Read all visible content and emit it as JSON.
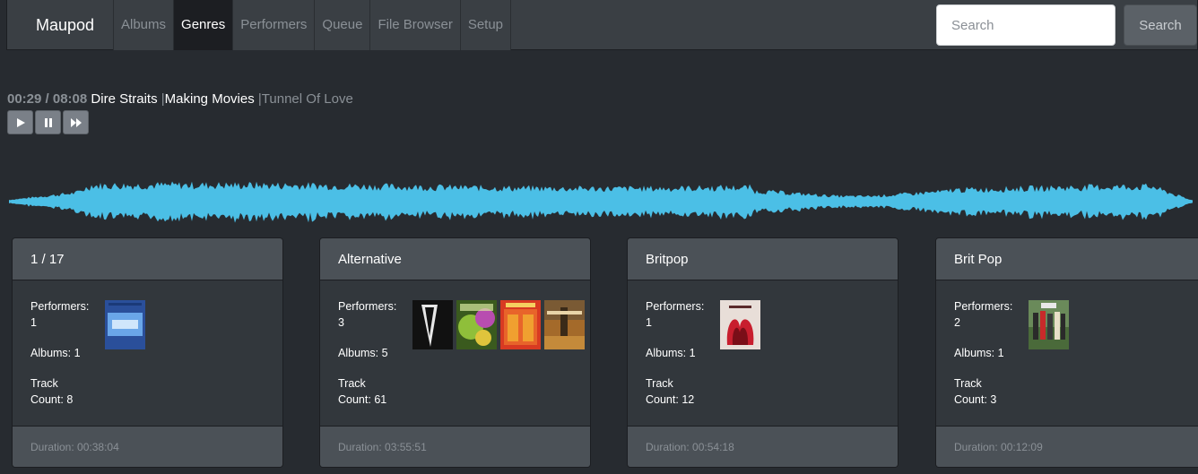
{
  "navbar": {
    "brand": "Maupod",
    "items": [
      {
        "label": "Albums",
        "active": false
      },
      {
        "label": "Genres",
        "active": true
      },
      {
        "label": "Performers",
        "active": false
      },
      {
        "label": "Queue",
        "active": false
      },
      {
        "label": "File Browser",
        "active": false
      },
      {
        "label": "Setup",
        "active": false
      }
    ],
    "search_placeholder": "Search",
    "search_button": "Search"
  },
  "player": {
    "time": "00:29 / 08:08",
    "artist": "Dire Straits",
    "album": "Making Movies",
    "track": "Tunnel Of Love",
    "separator": "|",
    "controls": [
      "play-icon",
      "pause-icon",
      "fast-forward-icon"
    ],
    "progress": 0.06,
    "waveform_color": "#4bbfe6"
  },
  "genres": [
    {
      "name": "1 / 17",
      "performers_label": "Performers:",
      "performers": "1",
      "albums_label": "Albums:",
      "albums": "1",
      "track_label": "Track",
      "count_label": "Count:",
      "track_count": "8",
      "duration_label": "Duration:",
      "duration": "00:38:04"
    },
    {
      "name": "Alternative",
      "performers_label": "Performers:",
      "performers": "3",
      "albums_label": "Albums:",
      "albums": "5",
      "track_label": "Track",
      "count_label": "Count:",
      "track_count": "61",
      "duration_label": "Duration:",
      "duration": "03:55:51"
    },
    {
      "name": "Britpop",
      "performers_label": "Performers:",
      "performers": "1",
      "albums_label": "Albums:",
      "albums": "1",
      "track_label": "Track",
      "count_label": "Count:",
      "track_count": "12",
      "duration_label": "Duration:",
      "duration": "00:54:18"
    },
    {
      "name": "Brit Pop",
      "performers_label": "Performers:",
      "performers": "2",
      "albums_label": "Albums:",
      "albums": "1",
      "track_label": "Track",
      "count_label": "Count:",
      "track_count": "3",
      "duration_label": "Duration:",
      "duration": "00:12:09"
    }
  ],
  "theme": {
    "background": "#272b30",
    "navbar": "#3a3f44",
    "active_nav": "#1c1e22",
    "card_header": "#4b5157",
    "card_body": "#32373c"
  }
}
